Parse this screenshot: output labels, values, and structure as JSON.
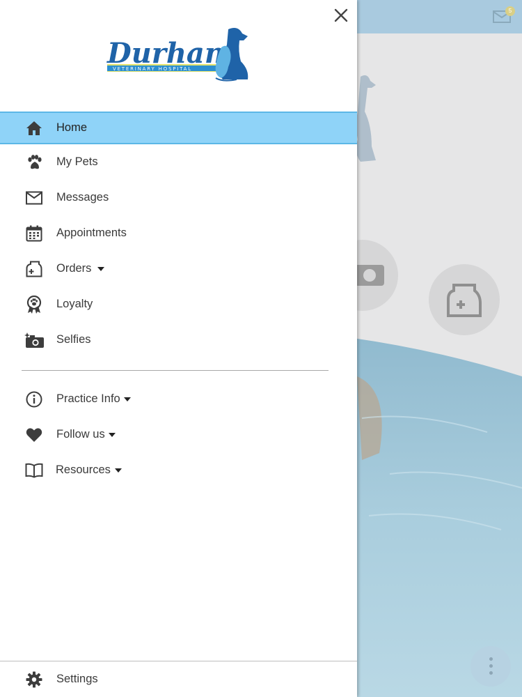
{
  "background": {
    "mail_badge_count": "5",
    "header_color": "#a9cadf"
  },
  "drawer": {
    "logo": {
      "name": "Durham",
      "subtitle": "VETERINARY HOSPITAL"
    },
    "menu": [
      {
        "label": "Home",
        "icon": "home-icon",
        "active": true
      },
      {
        "label": "My Pets",
        "icon": "paw-icon"
      },
      {
        "label": "Messages",
        "icon": "mail-icon"
      },
      {
        "label": "Appointments",
        "icon": "calendar-icon"
      },
      {
        "label": "Orders",
        "icon": "food-bag-icon",
        "dropdown": true
      },
      {
        "label": "Loyalty",
        "icon": "award-ribbon-icon"
      },
      {
        "label": "Selfies",
        "icon": "camera-sparkle-icon"
      }
    ],
    "secondary_menu": [
      {
        "label": "Practice Info",
        "icon": "info-icon",
        "dropdown": true
      },
      {
        "label": "Follow us",
        "icon": "heart-icon",
        "dropdown": true
      },
      {
        "label": "Resources",
        "icon": "book-icon",
        "dropdown": true
      }
    ],
    "settings_label": "Settings"
  },
  "colors": {
    "active_bg": "#8fd3f8",
    "active_border": "#5cb7e6",
    "brand_blue": "#1f63a8",
    "icon_dark": "#3d3d3d"
  }
}
